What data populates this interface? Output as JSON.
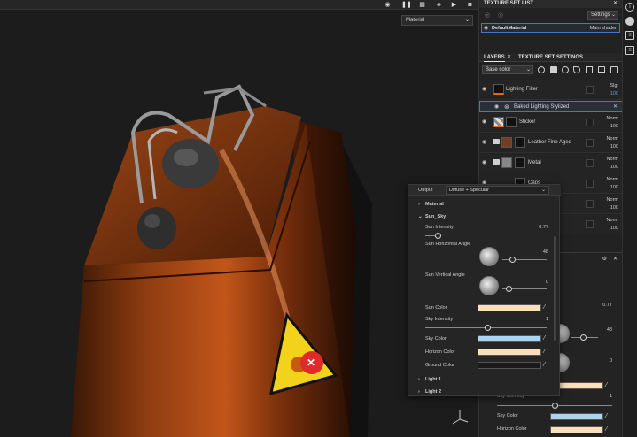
{
  "viewport": {
    "material_select": "Material",
    "sticker_mark": "✕"
  },
  "texture_set_list": {
    "title": "TEXTURE SET LIST",
    "settings_label": "Settings",
    "material_name": "DefaultMaterial",
    "shader_name": "Main shader"
  },
  "layers_panel": {
    "tab_layers": "LAYERS",
    "tab_texture_set_settings": "TEXTURE SET SETTINGS",
    "channel_select": "Base color",
    "layers": [
      {
        "name": "Lighting Filter",
        "blend": "Slgt",
        "opacity": "100",
        "thumb_color": "#111"
      },
      {
        "name": "Baked Lighting Stylized",
        "is_effect": true
      },
      {
        "name": "Sticker",
        "blend": "Norm",
        "opacity": "100",
        "thumb_color": "#ddd"
      },
      {
        "name": "Leather Fine Aged",
        "blend": "Norm",
        "opacity": "100",
        "thumb_color": "#7a3c1e"
      },
      {
        "name": "Metal",
        "blend": "Norm",
        "opacity": "100",
        "thumb_color": "#888"
      },
      {
        "name": "Caps",
        "blend": "Norm",
        "opacity": "100",
        "thumb_color": "#222"
      },
      {
        "name": "",
        "blend": "Norm",
        "opacity": "100",
        "thumb_color": "#333"
      },
      {
        "name": "",
        "blend": "Norm",
        "opacity": "100",
        "thumb_color": "#333"
      }
    ]
  },
  "properties_bg": {
    "value_1": "0.77",
    "value_2": "48",
    "value_3": "0",
    "value_4": "1",
    "sky_intensity_label": "Sky Intensity",
    "sky_color_label": "Sky Color",
    "horizon_color_label": "Horizon Color"
  },
  "popup": {
    "output_label": "Output",
    "output_value": "Diffuse + Specular",
    "section_material": "Material",
    "section_sun_sky": "Sun_Sky",
    "sun_intensity_label": "Sun Intensity",
    "sun_intensity_value": "0.77",
    "sun_horizontal_angle_label": "Sun Horizontal Angle",
    "sun_horizontal_angle_value": "48",
    "sun_vertical_angle_label": "Sun Vertical Angle",
    "sun_vertical_angle_value": "0",
    "sun_color_label": "Sun Color",
    "sky_intensity_label": "Sky Intensity",
    "sky_intensity_value": "1",
    "sky_color_label": "Sky Color",
    "horizon_color_label": "Horizon Color",
    "ground_color_label": "Ground Color",
    "section_light1": "Light 1",
    "section_light2": "Light 2",
    "colors": {
      "sun": "#fbdfb8",
      "sky": "#a8d6f2",
      "horizon": "#fbdfb8",
      "ground": "#1a1a1a"
    }
  }
}
